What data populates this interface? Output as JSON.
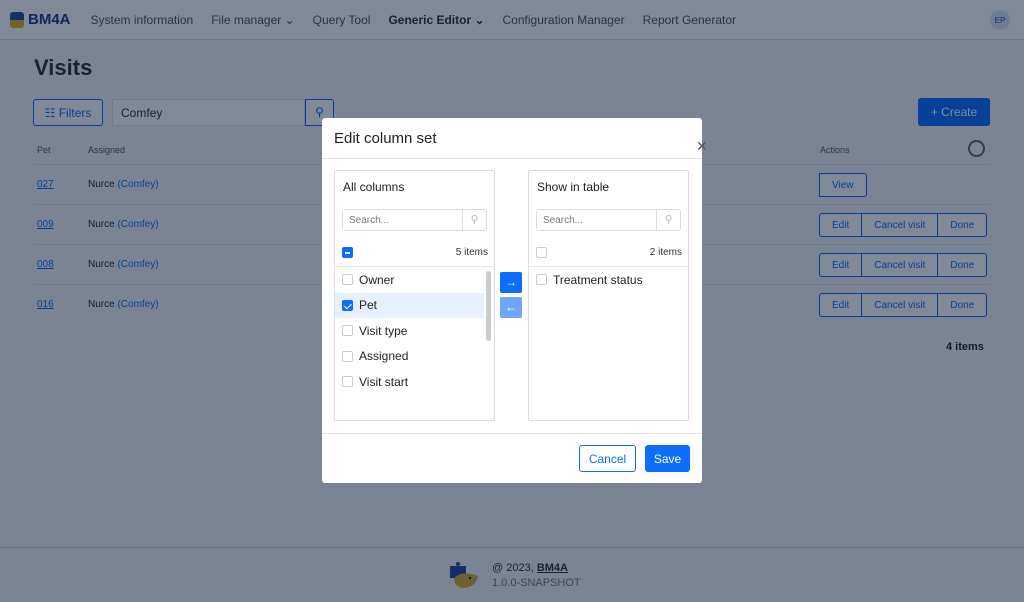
{
  "nav": {
    "brand": "BM4A",
    "items": [
      {
        "label": "System information"
      },
      {
        "label": "File manager ⌄"
      },
      {
        "label": "Query Tool"
      },
      {
        "label": "Generic Editor ⌄"
      },
      {
        "label": "Configuration Manager"
      },
      {
        "label": "Report Generator"
      }
    ],
    "avatar": "EP"
  },
  "page": {
    "title": "Visits",
    "filters_label": "☷ Filters",
    "search_value": "Comfey",
    "create_label": "+ Create",
    "headers": {
      "pet": "Pet",
      "assigned": "Assigned",
      "actions": "Actions"
    },
    "rows": [
      {
        "pet": "027",
        "assigned": "Nurce",
        "assigned_link": "(Comfey)",
        "actions": [
          "View"
        ]
      },
      {
        "pet": "009",
        "assigned": "Nurce",
        "assigned_link": "(Comfey)",
        "actions": [
          "Edit",
          "Cancel visit",
          "Done"
        ]
      },
      {
        "pet": "008",
        "assigned": "Nurce",
        "assigned_link": "(Comfey)",
        "actions": [
          "Edit",
          "Cancel visit",
          "Done"
        ]
      },
      {
        "pet": "016",
        "assigned": "Nurce",
        "assigned_link": "(Comfey)",
        "actions": [
          "Edit",
          "Cancel visit",
          "Done"
        ]
      }
    ],
    "count": "4 items"
  },
  "footer": {
    "copyright": "@ 2023,",
    "brand_link": "BM4A",
    "version": "1.0.0-SNAPSHOT"
  },
  "modal": {
    "title": "Edit column set",
    "left": {
      "title": "All columns",
      "placeholder": "Search...",
      "count": "5 items",
      "items": [
        {
          "label": "Owner",
          "checked": false
        },
        {
          "label": "Pet",
          "checked": true
        },
        {
          "label": "Visit type",
          "checked": false
        },
        {
          "label": "Assigned",
          "checked": false
        },
        {
          "label": "Visit start",
          "checked": false
        }
      ]
    },
    "right": {
      "title": "Show in table",
      "placeholder": "Search...",
      "count": "2 items",
      "items": [
        {
          "label": "Treatment status",
          "checked": false
        }
      ]
    },
    "move_right": "→",
    "move_left": "←",
    "cancel_label": "Cancel",
    "save_label": "Save"
  },
  "colors": {
    "primary": "#0d6efd",
    "overlay": "rgba(0,20,50,0.5)"
  }
}
